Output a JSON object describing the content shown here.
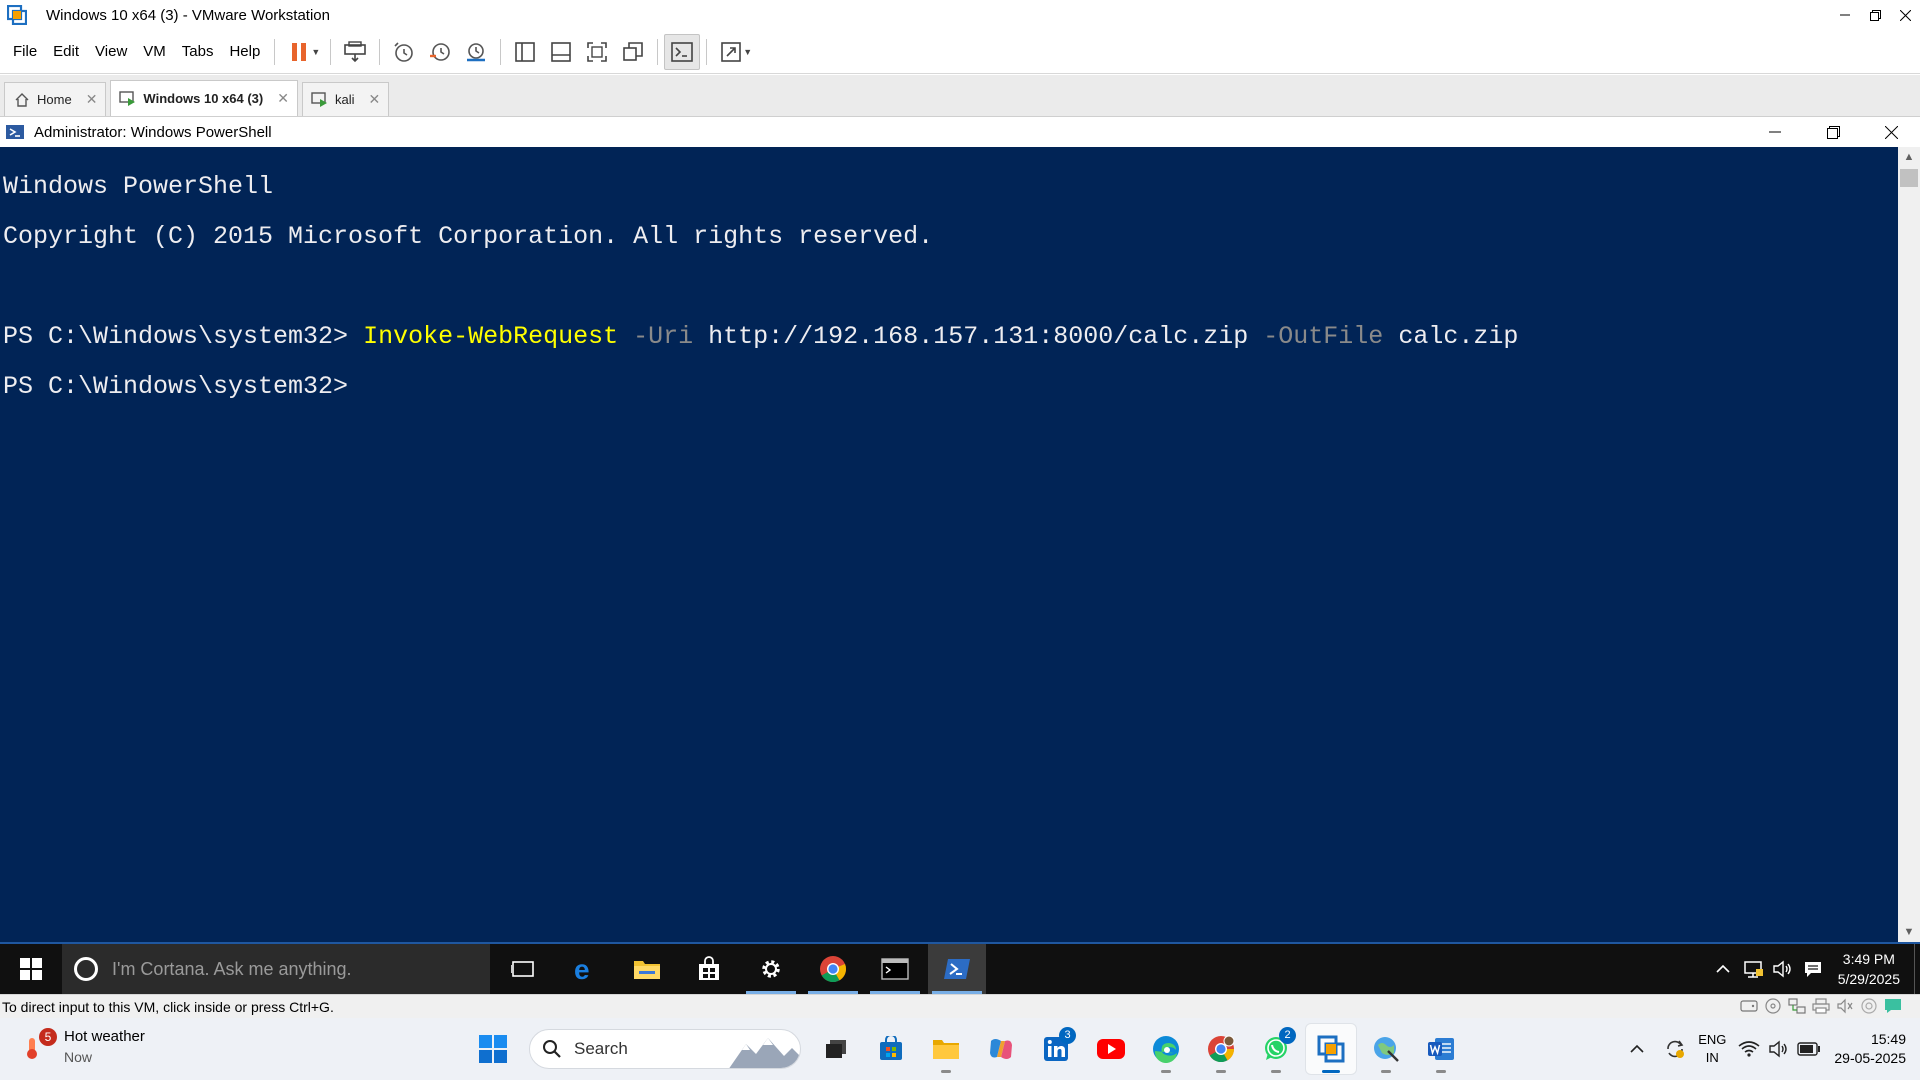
{
  "vmware": {
    "title": "Windows 10 x64 (3) - VMware Workstation",
    "menu": [
      "File",
      "Edit",
      "View",
      "VM",
      "Tabs",
      "Help"
    ],
    "tabs": [
      {
        "label": "Home",
        "active": false
      },
      {
        "label": "Windows 10 x64 (3)",
        "active": true
      },
      {
        "label": "kali",
        "active": false
      }
    ],
    "status_text": "To direct input to this VM, click inside or press Ctrl+G."
  },
  "powershell": {
    "title": "Administrator: Windows PowerShell",
    "lines": {
      "banner1": "Windows PowerShell",
      "banner2": "Copyright (C) 2015 Microsoft Corporation. All rights reserved.",
      "prompt1": "PS C:\\Windows\\system32> ",
      "cmd_name": "Invoke-WebRequest",
      "param_uri": "-Uri",
      "arg_uri": "http://192.168.157.131:8000/calc.zip",
      "param_outfile": "-OutFile",
      "arg_outfile": "calc.zip",
      "prompt2": "PS C:\\Windows\\system32>"
    }
  },
  "guest_taskbar": {
    "cortana_placeholder": "I'm Cortana. Ask me anything.",
    "clock_time": "3:49 PM",
    "clock_date": "5/29/2025"
  },
  "host_taskbar": {
    "weather_title": "Hot weather",
    "weather_sub": "Now",
    "weather_badge": "5",
    "search_placeholder": "Search",
    "linkedin_badge": "3",
    "whatsapp_badge": "2",
    "lang_1": "ENG",
    "lang_2": "IN",
    "clock_time": "15:49",
    "clock_date": "29-05-2025"
  },
  "colors": {
    "ps_background": "#012456",
    "ps_command": "#ffff00",
    "ps_parameter": "#8a8a8a",
    "pause_icon": "#e8642c",
    "accent": "#0067c0"
  }
}
